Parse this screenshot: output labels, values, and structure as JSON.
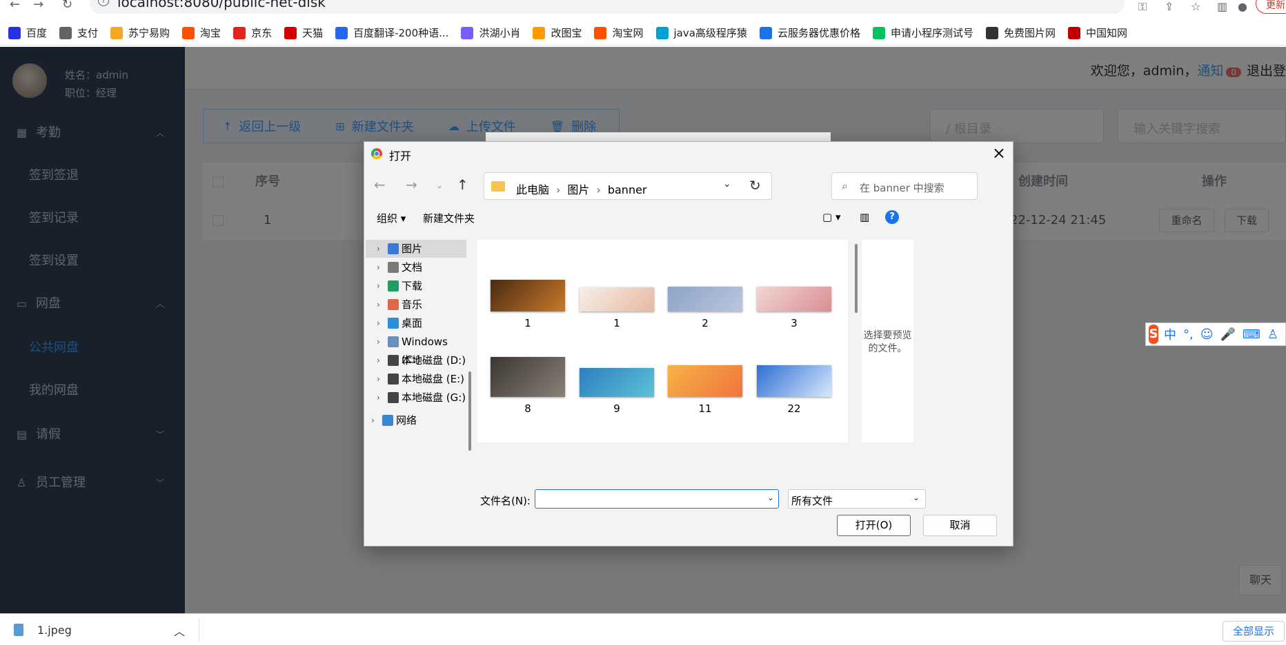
{
  "browser": {
    "url": "localhost:8080/public-net-disk",
    "update_label": "更新",
    "bookmarks": [
      {
        "label": "百度",
        "icon": "baidu-icon",
        "color": "#2932e1"
      },
      {
        "label": "支付",
        "icon": "globe-icon",
        "color": "#5f6368"
      },
      {
        "label": "苏宁易购",
        "icon": "suning-icon",
        "color": "#f5a623"
      },
      {
        "label": "淘宝",
        "icon": "taobao-icon",
        "color": "#ff5000"
      },
      {
        "label": "京东",
        "icon": "jd-icon",
        "color": "#e1251b"
      },
      {
        "label": "天猫",
        "icon": "tmall-icon",
        "color": "#d40000"
      },
      {
        "label": "百度翻译-200种语...",
        "icon": "translate-icon",
        "color": "#2468f2"
      },
      {
        "label": "洪湖小肖",
        "icon": "bird-icon",
        "color": "#7a5cff"
      },
      {
        "label": "改图宝",
        "icon": "gaitubao-icon",
        "color": "#ff9900"
      },
      {
        "label": "淘宝网",
        "icon": "taobao-icon",
        "color": "#ff5000"
      },
      {
        "label": "java高级程序猿",
        "icon": "bilibili-icon",
        "color": "#00a1d6"
      },
      {
        "label": "云服务器优惠价格",
        "icon": "cloud-icon",
        "color": "#1a73e8"
      },
      {
        "label": "申请小程序测试号",
        "icon": "wechat-icon",
        "color": "#07c160"
      },
      {
        "label": "免费图片网",
        "icon": "t-icon",
        "color": "#333333"
      },
      {
        "label": "中国知网",
        "icon": "cnki-icon",
        "color": "#c00000"
      }
    ]
  },
  "sidebar": {
    "user_name": "姓名：admin",
    "user_position": "职位：经理",
    "menus": [
      {
        "label": "考勤",
        "icon": "grid-icon"
      },
      {
        "label": "签到签退"
      },
      {
        "label": "签到记录"
      },
      {
        "label": "签到设置"
      },
      {
        "label": "网盘",
        "icon": "folder-icon"
      },
      {
        "label": "公共网盘"
      },
      {
        "label": "我的网盘"
      },
      {
        "label": "请假",
        "icon": "document-icon"
      },
      {
        "label": "员工管理",
        "icon": "user-icon"
      }
    ]
  },
  "header": {
    "welcome": "欢迎您，admin，",
    "notify": "通知",
    "notify_count": "0",
    "logout": "退出登"
  },
  "toolbar": {
    "back": "返回上一级",
    "new_folder": "新建文件夹",
    "upload": "上传文件",
    "delete": "删除",
    "path_placeholder": "/ 根目录",
    "search_placeholder": "输入关键字搜索"
  },
  "table": {
    "headers": {
      "index": "序号",
      "created": "创建时间",
      "actions": "操作"
    },
    "rows": [
      {
        "index": "1",
        "created": "22-12-24 21:45",
        "rename": "重命名",
        "download": "下载"
      }
    ]
  },
  "chat_label": "聊天",
  "ime": {
    "lang": "中",
    "punct": "°,"
  },
  "dialog": {
    "title": "打开",
    "breadcrumb": [
      "此电脑",
      "图片",
      "banner"
    ],
    "search_placeholder": "在 banner 中搜索",
    "organize": "组织 ▾",
    "new_folder": "新建文件夹",
    "tree": [
      {
        "label": "图片",
        "icon": "pictures-icon",
        "color": "#3c78d8"
      },
      {
        "label": "文档",
        "icon": "documents-icon",
        "color": "#7a7a7a"
      },
      {
        "label": "下载",
        "icon": "download-icon",
        "color": "#1e9e62"
      },
      {
        "label": "音乐",
        "icon": "music-icon",
        "color": "#e0664a"
      },
      {
        "label": "桌面",
        "icon": "desktop-icon",
        "color": "#2d8fd5"
      },
      {
        "label": "Windows (C:)",
        "icon": "windows-drive-icon",
        "color": "#6a8fbf"
      },
      {
        "label": "本地磁盘 (D:)",
        "icon": "drive-icon",
        "color": "#444444"
      },
      {
        "label": "本地磁盘 (E:)",
        "icon": "drive-icon",
        "color": "#444444"
      },
      {
        "label": "本地磁盘 (G:)",
        "icon": "drive-icon",
        "color": "#444444"
      },
      {
        "label": "网络",
        "icon": "network-icon",
        "color": "#3a86d4"
      }
    ],
    "files": [
      {
        "name": "1",
        "colors": [
          "#4a2a12",
          "#c87a2a"
        ]
      },
      {
        "name": "1",
        "colors": [
          "#f5f0ea",
          "#e8b8a0"
        ]
      },
      {
        "name": "2",
        "colors": [
          "#8fa3c8",
          "#b9c6dd"
        ]
      },
      {
        "name": "3",
        "colors": [
          "#f1d6d2",
          "#d98f93"
        ]
      },
      {
        "name": "8",
        "colors": [
          "#3a3632",
          "#8a8078"
        ]
      },
      {
        "name": "9",
        "colors": [
          "#2e7fbf",
          "#5cc2d8"
        ]
      },
      {
        "name": "11",
        "colors": [
          "#f7b347",
          "#f0733a"
        ]
      },
      {
        "name": "22",
        "colors": [
          "#2f6fd3",
          "#d8e8fb"
        ]
      }
    ],
    "preview_text": "选择要预览的文件。",
    "filename_label": "文件名(N):",
    "filename_value": "",
    "filetype": "所有文件",
    "open": "打开(O)",
    "cancel": "取消"
  },
  "downloads": {
    "file": "1.jpeg",
    "show_all": "全部显示"
  }
}
